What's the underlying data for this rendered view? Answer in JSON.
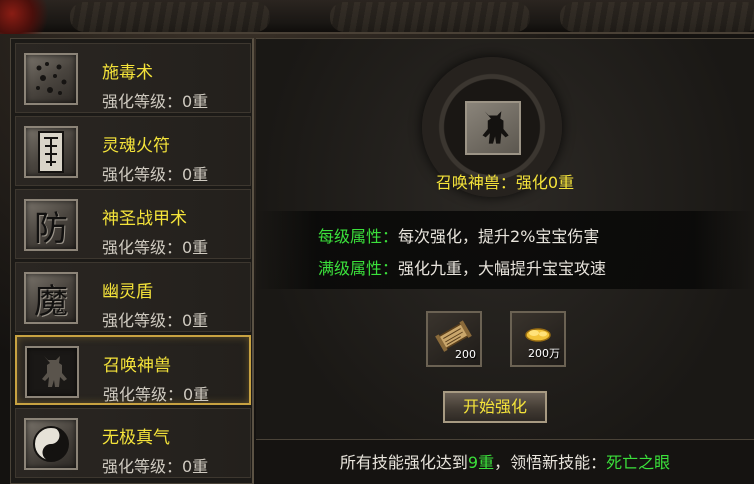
{
  "skills": [
    {
      "name": "施毒术",
      "level": "强化等级：0重",
      "icon": "poison-dots-icon"
    },
    {
      "name": "灵魂火符",
      "level": "强化等级：0重",
      "icon": "talisman-icon"
    },
    {
      "name": "神圣战甲术",
      "level": "强化等级：0重",
      "icon": "defense-glyph-icon",
      "glyph": "防"
    },
    {
      "name": "幽灵盾",
      "level": "强化等级：0重",
      "icon": "demon-glyph-icon",
      "glyph": "魔"
    },
    {
      "name": "召唤神兽",
      "level": "强化等级：0重",
      "icon": "beast-icon",
      "selected": true
    },
    {
      "name": "无极真气",
      "level": "强化等级：0重",
      "icon": "yin-yang-icon"
    }
  ],
  "detail": {
    "title": "召唤神兽：强化0重",
    "attr1_key": "每级属性：",
    "attr1_val": "每次强化，提升2%宝宝伤害",
    "attr2_key": "满级属性：",
    "attr2_val": "强化九重，大幅提升宝宝攻速",
    "cost1_amount": "200",
    "cost2_amount": "200万",
    "start_button": "开始强化",
    "footer_prefix": "所有技能强化达到",
    "footer_level": "9重",
    "footer_middle": "，领悟新技能：",
    "footer_skill": "死亡之眼"
  },
  "colors": {
    "accent": "#f4e33a",
    "green": "#3be03b",
    "selected_border": "#c8a241"
  }
}
